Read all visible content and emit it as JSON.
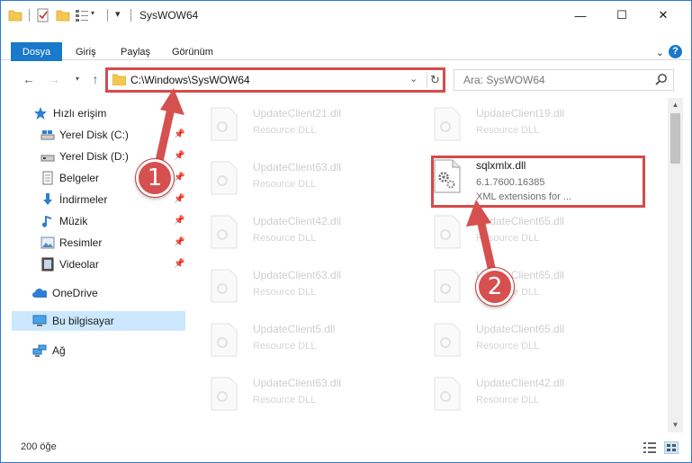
{
  "window": {
    "title": "SysWOW64",
    "controls": {
      "minimize": "—",
      "maximize": "☐",
      "close": "✕"
    }
  },
  "ribbon": {
    "tabs": [
      "Dosya",
      "Giriş",
      "Paylaş",
      "Görünüm"
    ],
    "help": "?"
  },
  "navigation": {
    "address": "C:\\Windows\\SysWOW64",
    "search_placeholder": "Ara: SysWOW64"
  },
  "sidebar": {
    "quick_access": "Hızlı erişim",
    "items": [
      {
        "label": "Yerel Disk (C:)",
        "icon": "drive-icon",
        "pinned": true
      },
      {
        "label": "Yerel Disk (D:)",
        "icon": "drive-icon",
        "pinned": true
      },
      {
        "label": "Belgeler",
        "icon": "documents-icon",
        "pinned": true
      },
      {
        "label": "İndirmeler",
        "icon": "downloads-icon",
        "pinned": true
      },
      {
        "label": "Müzik",
        "icon": "music-icon",
        "pinned": true
      },
      {
        "label": "Resimler",
        "icon": "pictures-icon",
        "pinned": true
      },
      {
        "label": "Videolar",
        "icon": "videos-icon",
        "pinned": true
      }
    ],
    "onedrive": "OneDrive",
    "this_pc": "Bu bilgisayar",
    "network": "Ağ"
  },
  "files": [
    {
      "name": "UpdateClient21.dll",
      "type": "Resource DLL"
    },
    {
      "name": "UpdateClient19.dll",
      "type": "Resource DLL"
    },
    {
      "name": "UpdateClient63.dll",
      "type": "Resource DLL"
    },
    {
      "name": "sqlxmlx.dll",
      "type": "6.1.7600.16385",
      "desc": "XML extensions for ...",
      "active": true
    },
    {
      "name": "UpdateClient42.dll",
      "type": "Resource DLL"
    },
    {
      "name": "UpdateClient65.dll",
      "type": "Resource DLL"
    },
    {
      "name": "UpdateClient63.dll",
      "type": "Resource DLL"
    },
    {
      "name": "UpdateClient65.dll",
      "type": "Resource DLL"
    },
    {
      "name": "UpdateClient5.dll",
      "type": "Resource DLL"
    },
    {
      "name": "UpdateClient65.dll",
      "type": "Resource DLL"
    },
    {
      "name": "UpdateClient63.dll",
      "type": "Resource DLL"
    },
    {
      "name": "UpdateClient42.dll",
      "type": "Resource DLL"
    }
  ],
  "status": {
    "item_count": "200 öğe"
  },
  "callouts": [
    "1",
    "2"
  ],
  "colors": {
    "accent": "#1979ca",
    "highlight": "#d64a4a",
    "selected": "#cce8ff"
  }
}
